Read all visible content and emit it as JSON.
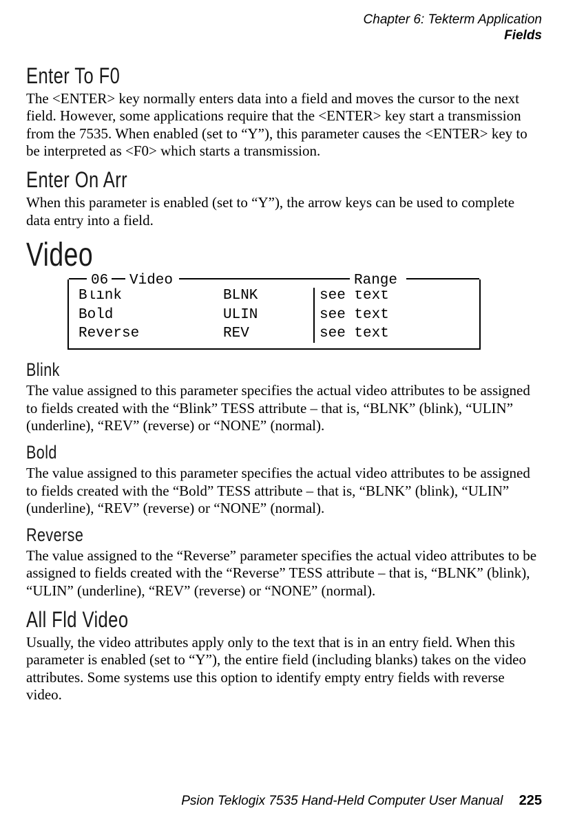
{
  "header": {
    "chapter": "Chapter  6:  Tekterm Application",
    "section": "Fields"
  },
  "s1": {
    "title": "Enter To F0",
    "body": "The <ENTER> key normally enters data into a field and moves the cursor to the next field. However, some applications require that the <ENTER> key start a transmission from the 7535. When enabled (set to “Y”), this parameter causes the <ENTER> key to be interpreted as <F0> which starts a transmission."
  },
  "s2": {
    "title": "Enter On Arr",
    "body": "When this parameter is enabled (set to “Y”), the arrow keys can be used to complete data entry into a field."
  },
  "video": {
    "title": "Video",
    "legend_left": "06",
    "legend_mid": "Video",
    "legend_right": "Range",
    "rows": [
      {
        "name": "Blink",
        "val": "BLNK",
        "range": "see text"
      },
      {
        "name": "Bold",
        "val": "ULIN",
        "range": "see text"
      },
      {
        "name": "Reverse",
        "val": "REV",
        "range": "see text"
      }
    ]
  },
  "s3": {
    "title": "Blink",
    "body": "The value assigned to this parameter specifies the actual video attributes to be assigned to fields created with the “Blink” TESS attribute – that is, “BLNK” (blink), “ULIN” (underline), “REV” (reverse) or “NONE” (normal)."
  },
  "s4": {
    "title": "Bold",
    "body": "The value assigned to this parameter specifies the actual video attributes to be assigned to fields created with the “Bold” TESS attribute – that is, “BLNK” (blink), “ULIN” (underline), “REV” (reverse) or “NONE” (normal)."
  },
  "s5": {
    "title": "Reverse",
    "body": "The value assigned to the “Reverse” parameter specifies the actual video attributes to be assigned to fields created with the “Reverse” TESS attribute – that is, “BLNK” (blink), “ULIN” (underline), “REV” (reverse) or “NONE” (normal)."
  },
  "s6": {
    "title": "All Fld Video",
    "body": "Usually, the video attributes apply only to the text that is in an entry field. When this parameter is enabled (set to “Y”), the entire field (including blanks) takes on the video attributes. Some systems use this option to identify empty entry fields with reverse video."
  },
  "footer": {
    "text": "Psion Teklogix 7535 Hand-Held Computer User Manual",
    "page": "225"
  }
}
